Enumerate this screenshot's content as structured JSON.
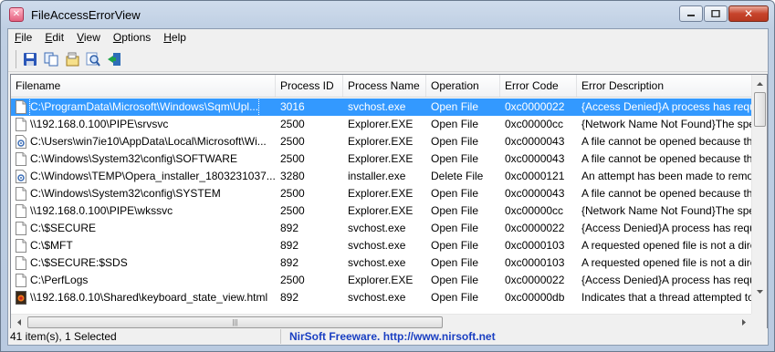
{
  "window": {
    "title": "FileAccessErrorView"
  },
  "menu": [
    {
      "label": "File",
      "accel": "F",
      "rest": "ile"
    },
    {
      "label": "Edit",
      "accel": "E",
      "rest": "dit"
    },
    {
      "label": "View",
      "accel": "V",
      "rest": "iew"
    },
    {
      "label": "Options",
      "accel": "O",
      "rest": "ptions"
    },
    {
      "label": "Help",
      "accel": "H",
      "rest": "elp"
    }
  ],
  "toolbar": {
    "buttons": [
      "save-icon",
      "copy-icon",
      "properties-icon",
      "find-icon",
      "exit-icon"
    ]
  },
  "columns": [
    "Filename",
    "Process ID",
    "Process Name",
    "Operation",
    "Error Code",
    "Error Description"
  ],
  "rows": [
    {
      "filename": "C:\\ProgramData\\Microsoft\\Windows\\Sqm\\Upl...",
      "pid": "3016",
      "process": "svchost.exe",
      "operation": "Open File",
      "code": "0xc0000022",
      "description": "{Access Denied}A process has reques",
      "icon": "blank-file-icon",
      "selected": true
    },
    {
      "filename": "\\\\192.168.0.100\\PIPE\\srvsvc",
      "pid": "2500",
      "process": "Explorer.EXE",
      "operation": "Open File",
      "code": "0xc00000cc",
      "description": "{Network Name Not Found}The spec",
      "icon": "blank-file-icon"
    },
    {
      "filename": "C:\\Users\\win7ie10\\AppData\\Local\\Microsoft\\Wi...",
      "pid": "2500",
      "process": "Explorer.EXE",
      "operation": "Open File",
      "code": "0xc0000043",
      "description": "A file cannot be opened because the",
      "icon": "settings-file-icon"
    },
    {
      "filename": "C:\\Windows\\System32\\config\\SOFTWARE",
      "pid": "2500",
      "process": "Explorer.EXE",
      "operation": "Open File",
      "code": "0xc0000043",
      "description": "A file cannot be opened because the",
      "icon": "blank-file-icon"
    },
    {
      "filename": "C:\\Windows\\TEMP\\Opera_installer_1803231037...",
      "pid": "3280",
      "process": "installer.exe",
      "operation": "Delete File",
      "code": "0xc0000121",
      "description": "An attempt has been made to remov",
      "icon": "settings-file-icon"
    },
    {
      "filename": "C:\\Windows\\System32\\config\\SYSTEM",
      "pid": "2500",
      "process": "Explorer.EXE",
      "operation": "Open File",
      "code": "0xc0000043",
      "description": "A file cannot be opened because the",
      "icon": "blank-file-icon"
    },
    {
      "filename": "\\\\192.168.0.100\\PIPE\\wkssvc",
      "pid": "2500",
      "process": "Explorer.EXE",
      "operation": "Open File",
      "code": "0xc00000cc",
      "description": "{Network Name Not Found}The spec",
      "icon": "blank-file-icon"
    },
    {
      "filename": "C:\\$SECURE",
      "pid": "892",
      "process": "svchost.exe",
      "operation": "Open File",
      "code": "0xc0000022",
      "description": "{Access Denied}A process has reques",
      "icon": "blank-file-icon"
    },
    {
      "filename": "C:\\$MFT",
      "pid": "892",
      "process": "svchost.exe",
      "operation": "Open File",
      "code": "0xc0000103",
      "description": "A requested opened file is not a dire",
      "icon": "blank-file-icon"
    },
    {
      "filename": "C:\\$SECURE:$SDS",
      "pid": "892",
      "process": "svchost.exe",
      "operation": "Open File",
      "code": "0xc0000103",
      "description": "A requested opened file is not a dire",
      "icon": "blank-file-icon"
    },
    {
      "filename": "C:\\PerfLogs",
      "pid": "2500",
      "process": "Explorer.EXE",
      "operation": "Open File",
      "code": "0xc0000022",
      "description": "{Access Denied}A process has reques",
      "icon": "blank-file-icon"
    },
    {
      "filename": "\\\\192.168.0.10\\Shared\\keyboard_state_view.html",
      "pid": "892",
      "process": "svchost.exe",
      "operation": "Open File",
      "code": "0xc00000db",
      "description": "Indicates that a thread attempted to",
      "icon": "browser-file-icon"
    }
  ],
  "status": {
    "count": "41 item(s), 1 Selected",
    "link": "NirSoft Freeware.  http://www.nirsoft.net"
  },
  "colors": {
    "selection": "#3399ff",
    "link": "#1a3fc2"
  }
}
